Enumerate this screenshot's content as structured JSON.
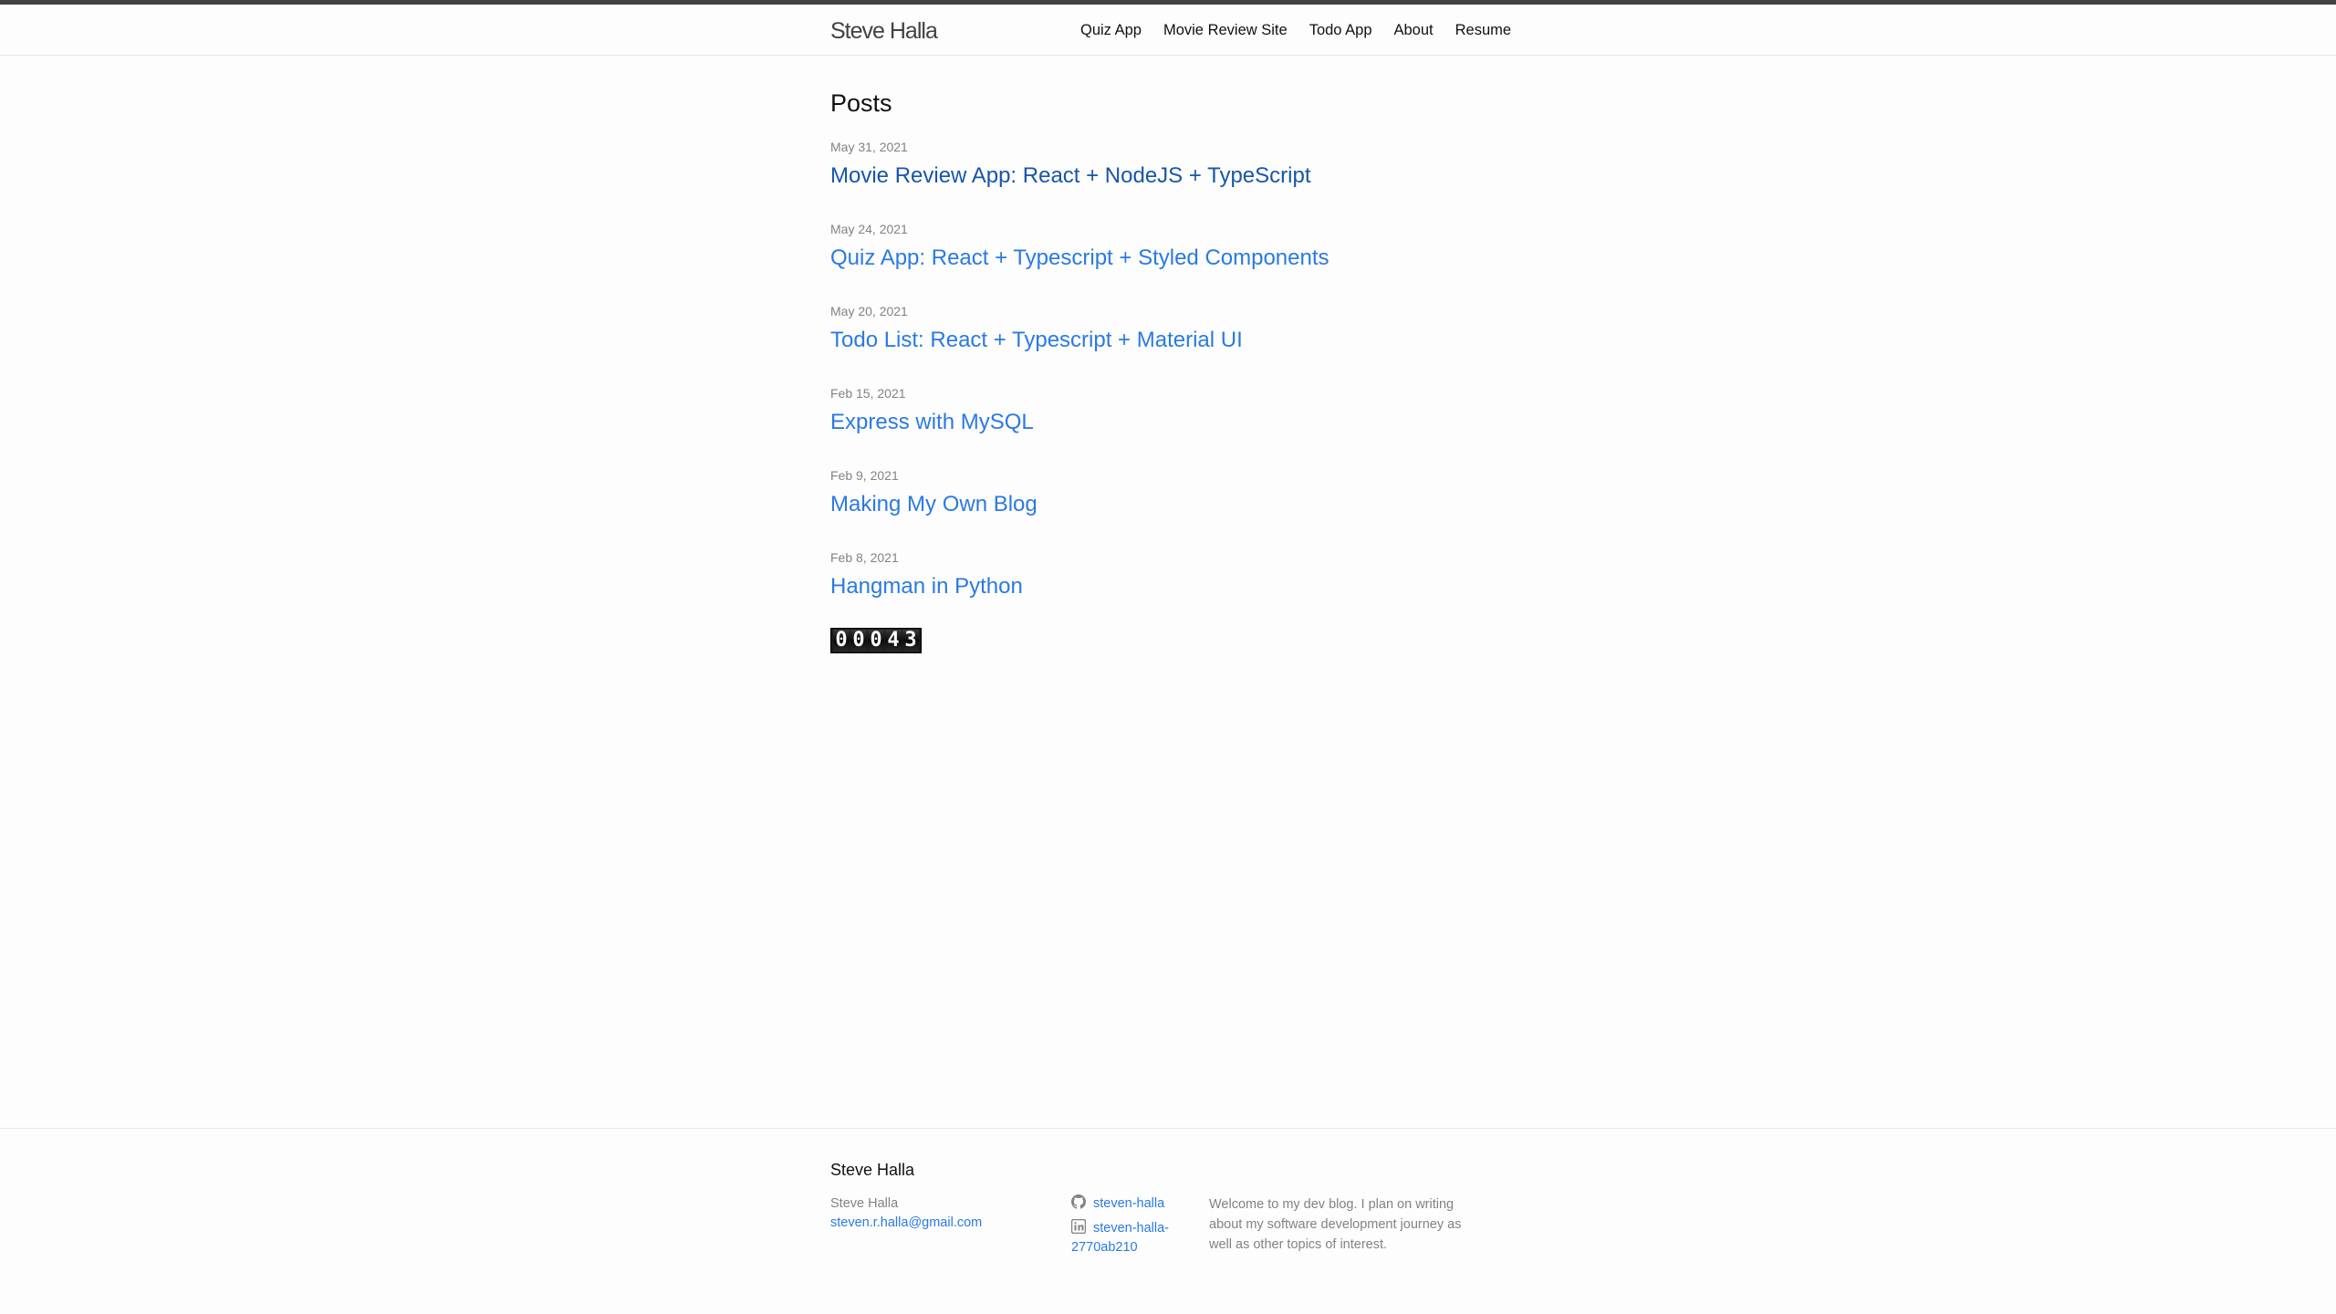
{
  "header": {
    "site_title": "Steve Halla",
    "nav": [
      {
        "label": "Quiz App"
      },
      {
        "label": "Movie Review Site"
      },
      {
        "label": "Todo App"
      },
      {
        "label": "About"
      },
      {
        "label": "Resume"
      }
    ]
  },
  "main": {
    "heading": "Posts",
    "posts": [
      {
        "date": "May 31, 2021",
        "title": "Movie Review App: React + NodeJS + TypeScript",
        "visited": true
      },
      {
        "date": "May 24, 2021",
        "title": "Quiz App: React + Typescript + Styled Components",
        "visited": false
      },
      {
        "date": "May 20, 2021",
        "title": "Todo List: React + Typescript + Material UI",
        "visited": false
      },
      {
        "date": "Feb 15, 2021",
        "title": "Express with MySQL",
        "visited": false
      },
      {
        "date": "Feb 9, 2021",
        "title": "Making My Own Blog",
        "visited": false
      },
      {
        "date": "Feb 8, 2021",
        "title": "Hangman in Python",
        "visited": false
      }
    ],
    "hit_counter": [
      "0",
      "0",
      "0",
      "4",
      "3"
    ]
  },
  "footer": {
    "heading": "Steve Halla",
    "name": "Steve Halla",
    "email": "steven.r.halla@gmail.com",
    "github": {
      "icon": "github-icon",
      "username": "steven-halla"
    },
    "linkedin": {
      "icon": "linkedin-icon",
      "username": "steven-halla-2770ab210"
    },
    "description": "Welcome to my dev blog. I plan on writing about my software development journey as well as other topics of interest."
  },
  "colors": {
    "link": "#2a7ae2",
    "link_visited": "#1756a9",
    "meta_grey": "#828282",
    "top_rule": "#424242"
  }
}
